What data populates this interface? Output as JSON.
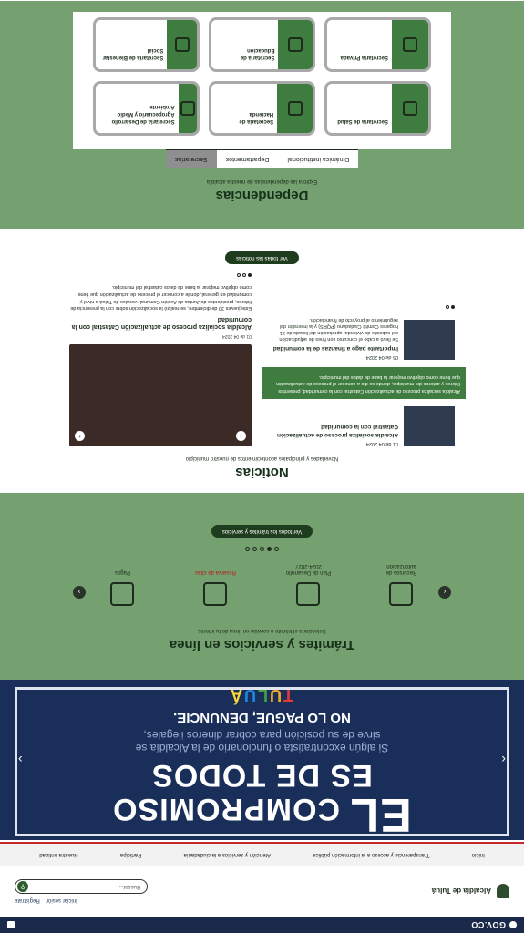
{
  "govbar": {
    "logo": "GOV.CO"
  },
  "header": {
    "brand": "Alcaldía de Tuluá",
    "links": [
      "Iniciar sesión",
      "Regístrate"
    ],
    "search_placeholder": "Buscar..."
  },
  "nav": {
    "items": [
      "Inicio",
      "Transparencia y acceso a la información pública",
      "Atención y servicios a la ciudadanía",
      "Participa",
      "Nuestra entidad"
    ]
  },
  "hero": {
    "line1": "EL",
    "line2": "COMPROMISO",
    "line3": "ES DE TODOS",
    "sub1": "Si algún excontratista o funcionario de la Alcaldía se",
    "sub2": "sirve de su posición para cobrar dineros ilegales,",
    "warn": "NO LO PAGUE, DENUNCIE.",
    "logo_letters": [
      "T",
      "U",
      "L",
      "U",
      "Á"
    ]
  },
  "tramites": {
    "title": "Trámites y servicios en línea",
    "subtitle": "Selecciona el trámite o servicio en línea de tu interés",
    "items": [
      {
        "label": "Recursos de autorización"
      },
      {
        "label": "Plan de Desarrollo 2024-2027"
      },
      {
        "label": "Reserva de citas",
        "highlight": true
      },
      {
        "label": "Pagos"
      }
    ],
    "cta": "Ver todos los trámites y servicios"
  },
  "noticias": {
    "title": "Noticias",
    "subtitle": "Novedades y principales acontecimientos de nuestro municipio",
    "main": {
      "date": "01 de 04 2024",
      "headline": "Alcaldía socializa proceso de actualización Catastral con la comunidad",
      "text": "Este jueves 30 de diciembre, se realizó la socialización sobre con la presencia de líderes, presidentes de Juntas de Acción Comunal, vocales de Tuluá a nivel y comunidad en general, donde a conocer el proceso de actualización que tiene como objetivo mejorar la base de datos catastral del municipio."
    },
    "side": [
      {
        "date": "01 de 04 2024",
        "headline": "Alcaldía socializa proceso de actualización Catastral con la comunidad"
      },
      {
        "date": "05 de 04 2024",
        "headline": "Importante pago a finanzas de la comunidad",
        "text": "Se llevó a cabo el concurso con fines de adjudicación del subsidio de vivienda, aprobación del listado de 31 hogares Comité Ciudadano (PQRS) y la inversión del seguimiento al proyecto de financiación."
      }
    ],
    "highlight": "Alcaldía socializa proceso de actualización Catastral con la comunidad, presentes líderes y actores del municipio, donde se dio a conocer el proceso de actualización que tiene como objetivo mejorar la base de datos del municipio.",
    "cta": "Ver todas las noticias"
  },
  "dependencias": {
    "title": "Dependencias",
    "subtitle": "Explora las dependencias de nuestra alcaldía",
    "tabs": [
      "Dinámica institucional",
      "Departamentos",
      "Secretarías"
    ],
    "cards": [
      "Secretaría de Salud",
      "Secretaría de Hacienda",
      "Secretaría de Desarrollo Agropecuario y Medio Ambiente",
      "Secretaría Privada",
      "Secretaría de Educación",
      "Secretaría de Bienestar Social"
    ]
  }
}
